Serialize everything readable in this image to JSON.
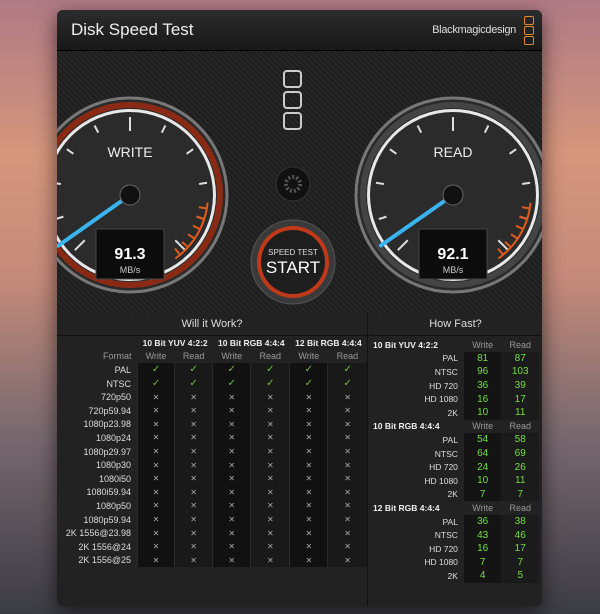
{
  "title": "Disk Speed Test",
  "brand": "Blackmagicdesign",
  "write": {
    "label": "WRITE",
    "value": "91.3",
    "unit": "MB/s"
  },
  "read": {
    "label": "READ",
    "value": "92.1",
    "unit": "MB/s"
  },
  "start_button": {
    "top": "SPEED TEST",
    "main": "START"
  },
  "will_it_work": {
    "title": "Will it Work?",
    "format_label": "Format",
    "groups": [
      "10 Bit YUV 4:2:2",
      "10 Bit RGB 4:4:4",
      "12 Bit RGB 4:4:4"
    ],
    "sub": [
      "Write",
      "Read"
    ],
    "rows": [
      {
        "f": "PAL",
        "ok": true
      },
      {
        "f": "NTSC",
        "ok": true
      },
      {
        "f": "720p50",
        "ok": false
      },
      {
        "f": "720p59.94",
        "ok": false
      },
      {
        "f": "1080p23.98",
        "ok": false
      },
      {
        "f": "1080p24",
        "ok": false
      },
      {
        "f": "1080p29.97",
        "ok": false
      },
      {
        "f": "1080p30",
        "ok": false
      },
      {
        "f": "1080i50",
        "ok": false
      },
      {
        "f": "1080i59.94",
        "ok": false
      },
      {
        "f": "1080p50",
        "ok": false
      },
      {
        "f": "1080p59.94",
        "ok": false
      },
      {
        "f": "2K 1556@23.98",
        "ok": false
      },
      {
        "f": "2K 1556@24",
        "ok": false
      },
      {
        "f": "2K 1556@25",
        "ok": false
      }
    ],
    "check": "✓",
    "cross": "✕"
  },
  "how_fast": {
    "title": "How Fast?",
    "write_label": "Write",
    "read_label": "Read",
    "groups": [
      {
        "name": "10 Bit YUV 4:2:2",
        "rows": [
          [
            "PAL",
            "81",
            "87"
          ],
          [
            "NTSC",
            "96",
            "103"
          ],
          [
            "HD 720",
            "36",
            "39"
          ],
          [
            "HD 1080",
            "16",
            "17"
          ],
          [
            "2K",
            "10",
            "11"
          ]
        ]
      },
      {
        "name": "10 Bit RGB 4:4:4",
        "rows": [
          [
            "PAL",
            "54",
            "58"
          ],
          [
            "NTSC",
            "64",
            "69"
          ],
          [
            "HD 720",
            "24",
            "26"
          ],
          [
            "HD 1080",
            "10",
            "11"
          ],
          [
            "2K",
            "7",
            "7"
          ]
        ]
      },
      {
        "name": "12 Bit RGB 4:4:4",
        "rows": [
          [
            "PAL",
            "36",
            "38"
          ],
          [
            "NTSC",
            "43",
            "46"
          ],
          [
            "HD 720",
            "16",
            "17"
          ],
          [
            "HD 1080",
            "7",
            "7"
          ],
          [
            "2K",
            "4",
            "5"
          ]
        ]
      }
    ]
  },
  "colors": {
    "needle": "#3ab4f0",
    "accent": "#e05a1c",
    "ok": "#6fe03a"
  }
}
